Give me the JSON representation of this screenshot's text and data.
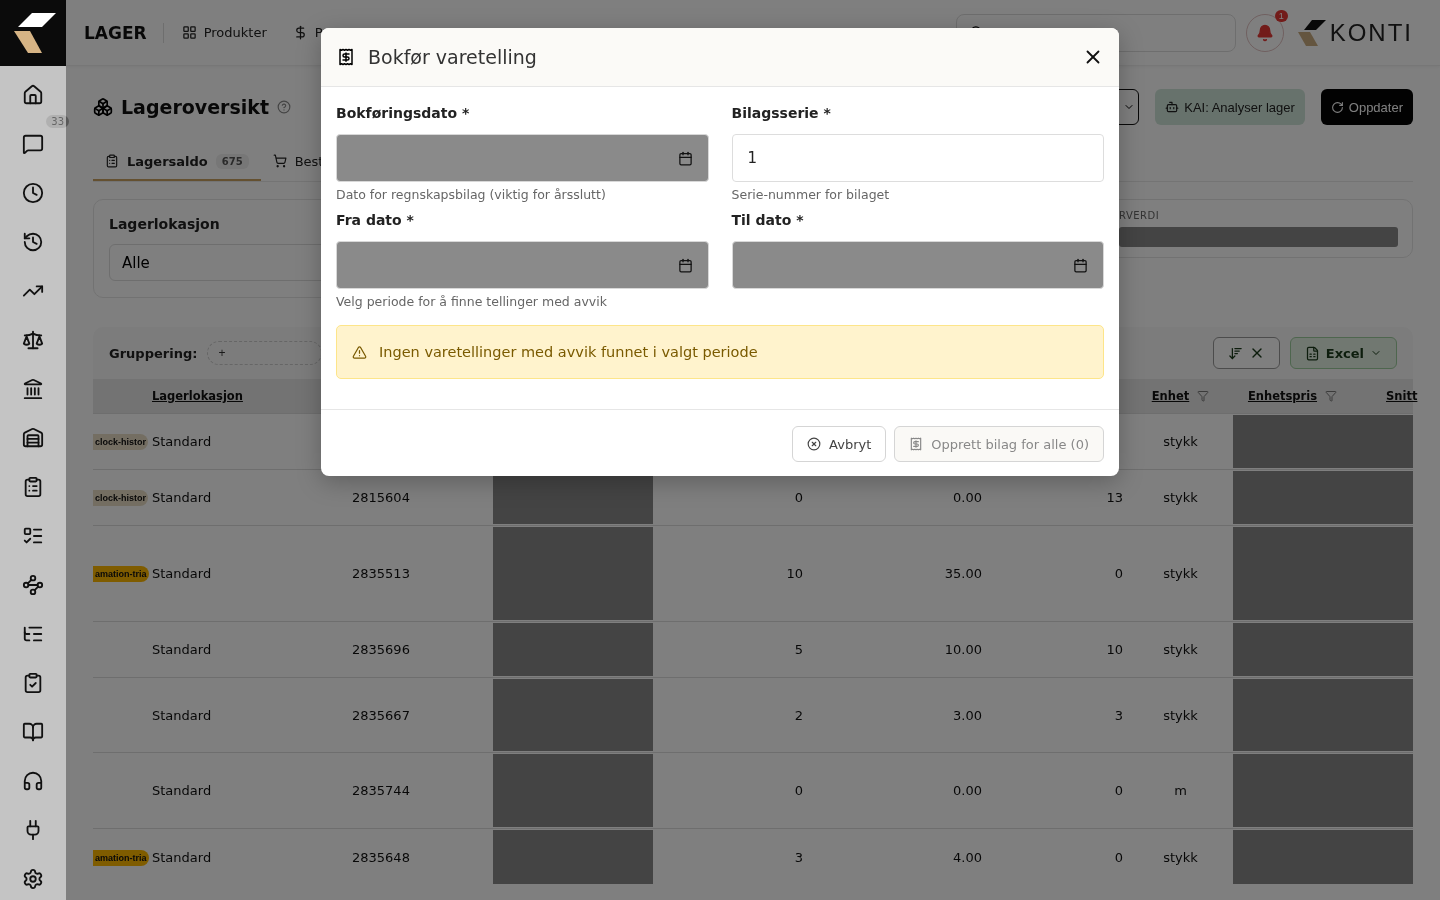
{
  "sidebar": {
    "badge": "33",
    "items": [
      {
        "selected": false
      },
      {
        "selected": false
      },
      {
        "selected": false
      },
      {
        "selected": false
      },
      {
        "selected": false
      },
      {
        "selected": false
      },
      {
        "selected": false
      },
      {
        "selected": false
      },
      {
        "selected": false
      },
      {
        "selected": false
      },
      {
        "selected": false
      },
      {
        "selected": false
      },
      {
        "selected": false
      },
      {
        "selected": false
      },
      {
        "selected": false
      },
      {
        "selected": false
      },
      {
        "selected": false
      }
    ]
  },
  "topbar": {
    "section": "LAGER",
    "nav": [
      {
        "label": "Produkter"
      },
      {
        "label": "P"
      }
    ],
    "notification_count": "1",
    "logo": "KONTI"
  },
  "page": {
    "title": "Lageroversikt",
    "actions": [
      {
        "label": "KAI: Analyser lager",
        "kind": "ai"
      },
      {
        "label": "Oppdater",
        "kind": "primary"
      }
    ],
    "tabs": [
      {
        "label": "Lagersaldo",
        "count": "675",
        "selected": true
      },
      {
        "label": "Best",
        "selected": false
      }
    ],
    "filter": {
      "label": "Lagerlokasjon",
      "value": "Alle"
    },
    "summary": {
      "label": "RVERDI"
    },
    "grouping": {
      "label": "Gruppering:",
      "add": "+"
    },
    "export": {
      "label": "Excel"
    }
  },
  "table": {
    "columns": [
      {
        "label": "Lagerlokasjon",
        "sorted": true
      },
      {
        "label": "Enhet"
      },
      {
        "label": "Enhetspris"
      },
      {
        "label": "Snitt"
      }
    ],
    "rows": [
      {
        "tag": {
          "text": "clock-histor",
          "kind": "history"
        },
        "location": "Standard",
        "unit": "stykk"
      },
      {
        "tag": {
          "text": "clock-histor",
          "kind": "history"
        },
        "location": "Standard",
        "number": "2815604",
        "qty": "0",
        "price": "0.00",
        "qty2": "13",
        "unit": "stykk"
      },
      {
        "tag": {
          "text": "amation-tria",
          "kind": "warning"
        },
        "location": "Standard",
        "number": "2835513",
        "qty": "10",
        "price": "35.00",
        "qty2": "0",
        "unit": "stykk"
      },
      {
        "location": "Standard",
        "number": "2835696",
        "qty": "5",
        "price": "10.00",
        "qty2": "10",
        "unit": "stykk"
      },
      {
        "location": "Standard",
        "number": "2835667",
        "qty": "2",
        "price": "3.00",
        "qty2": "3",
        "unit": "stykk"
      },
      {
        "location": "Standard",
        "number": "2835744",
        "qty": "0",
        "price": "0.00",
        "qty2": "0",
        "unit": "m"
      },
      {
        "tag": {
          "text": "amation-tria",
          "kind": "warning"
        },
        "location": "Standard",
        "number": "2835648",
        "qty": "3",
        "price": "4.00",
        "qty2": "0",
        "unit": "stykk"
      }
    ]
  },
  "dialog": {
    "title": "Bokfør varetelling",
    "fields": [
      {
        "label": "Bokføringsdato *",
        "kind": "date",
        "help": "Dato for regnskapsbilag (viktig for årsslutt)"
      },
      {
        "label": "Bilagsserie *",
        "kind": "text",
        "value": "1",
        "help": "Serie-nummer for bilaget"
      },
      {
        "label": "Fra dato *",
        "kind": "date",
        "help": "Velg periode for å finne tellinger med avvik"
      },
      {
        "label": "Til dato *",
        "kind": "date"
      }
    ],
    "alert": {
      "kind": "warning",
      "text": "Ingen varetellinger med avvik funnet i valgt periode"
    },
    "buttons": [
      {
        "label": "Avbryt",
        "kind": "cancel",
        "disabled": false
      },
      {
        "label": "Opprett bilag for alle (0)",
        "kind": "submit",
        "disabled": true
      }
    ]
  }
}
